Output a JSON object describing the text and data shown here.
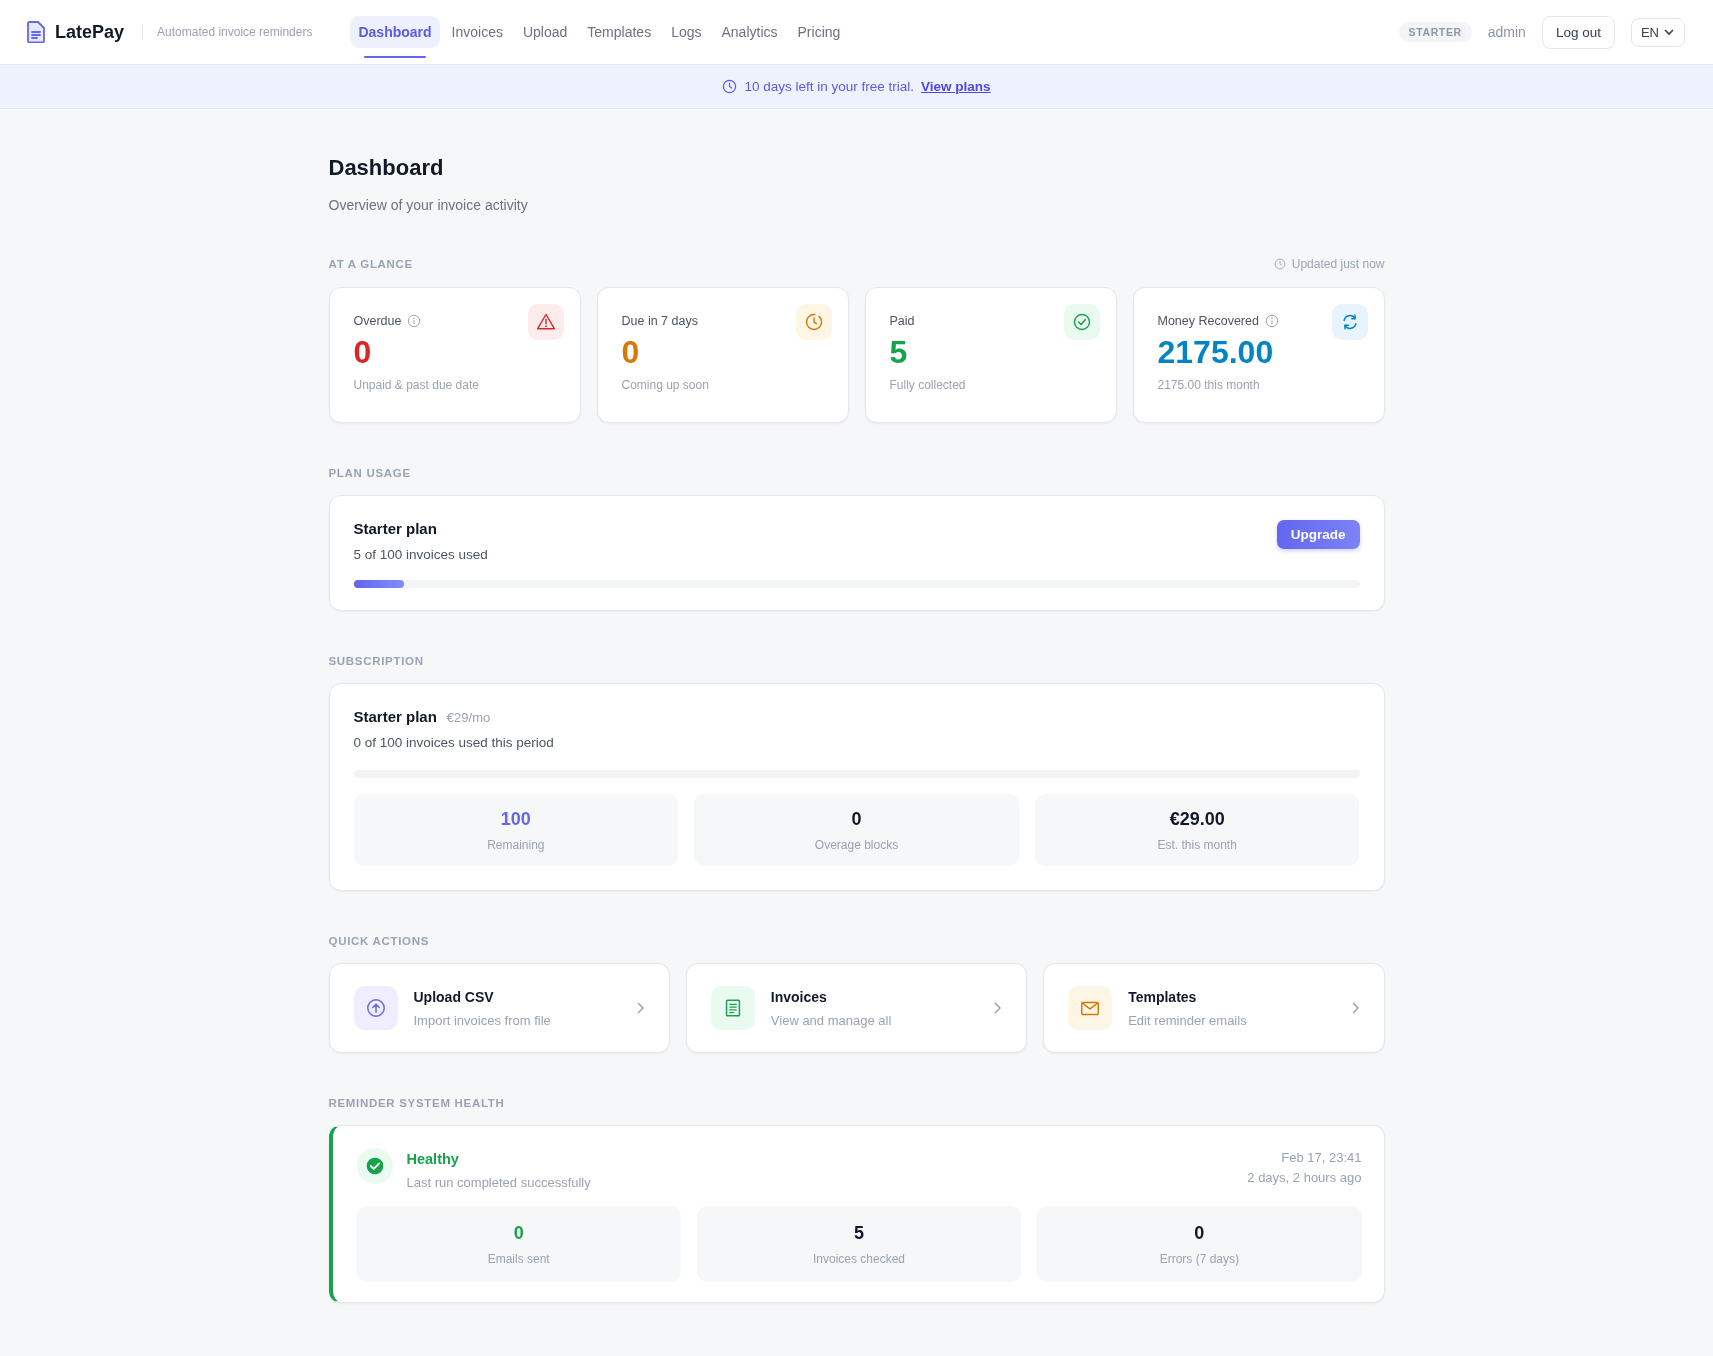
{
  "brand": {
    "name": "LatePay",
    "tagline": "Automated invoice reminders"
  },
  "nav": [
    {
      "label": "Dashboard",
      "selected": true
    },
    {
      "label": "Invoices",
      "selected": false
    },
    {
      "label": "Upload",
      "selected": false
    },
    {
      "label": "Templates",
      "selected": false
    },
    {
      "label": "Logs",
      "selected": false
    },
    {
      "label": "Analytics",
      "selected": false
    },
    {
      "label": "Pricing",
      "selected": false
    }
  ],
  "account": {
    "plan_badge": "STARTER",
    "user": "admin",
    "logout": "Log out",
    "language": "EN"
  },
  "trial_banner": {
    "text": "10 days left in your free trial.",
    "link": "View plans"
  },
  "page": {
    "title": "Dashboard",
    "subtitle": "Overview of your invoice activity"
  },
  "at_a_glance": {
    "heading": "AT A GLANCE",
    "updated": "Updated just now",
    "cards": [
      {
        "kind": "warning",
        "label": "Overdue",
        "info": true,
        "value": "0",
        "note": "Unpaid & past due date",
        "color": "#dc2626"
      },
      {
        "kind": "clock",
        "label": "Due in 7 days",
        "info": false,
        "value": "0",
        "note": "Coming up soon",
        "color": "#d97706"
      },
      {
        "kind": "check",
        "label": "Paid",
        "info": false,
        "value": "5",
        "note": "Fully collected",
        "color": "#16a34a"
      },
      {
        "kind": "refresh",
        "label": "Money Recovered",
        "info": true,
        "value": "2175.00",
        "note": "2175.00 this month",
        "color": "#0284c7"
      }
    ]
  },
  "plan_usage": {
    "heading": "PLAN USAGE",
    "title": "Starter plan",
    "usage": "5 of 100 invoices used",
    "level": 0.05,
    "button": "Upgrade"
  },
  "subscription": {
    "heading": "SUBSCRIPTION",
    "title": "Starter plan",
    "price": "€29/mo",
    "usage": "0 of 100 invoices used this period",
    "level": 0,
    "stats": [
      {
        "value": "100",
        "label": "Remaining",
        "color": "#6366f1"
      },
      {
        "value": "0",
        "label": "Overage blocks",
        "color": "#111827"
      },
      {
        "value": "€29.00",
        "label": "Est. this month",
        "color": "#111827"
      }
    ]
  },
  "quick_actions": {
    "heading": "QUICK ACTIONS",
    "items": [
      {
        "kind": "upload",
        "title": "Upload CSV",
        "subtitle": "Import invoices from file"
      },
      {
        "kind": "invoices",
        "title": "Invoices",
        "subtitle": "View and manage all"
      },
      {
        "kind": "templates",
        "title": "Templates",
        "subtitle": "Edit reminder emails"
      }
    ]
  },
  "health": {
    "heading": "REMINDER SYSTEM HEALTH",
    "healthy": true,
    "status": "Healthy",
    "message": "Last run completed successfully",
    "time": "Feb 17, 23:41",
    "ago": "2 days, 2 hours ago",
    "stats": [
      {
        "value": "0",
        "label": "Emails sent",
        "color": "#16a34a"
      },
      {
        "value": "5",
        "label": "Invoices checked",
        "color": "#111827"
      },
      {
        "value": "0",
        "label": "Errors (7 days)",
        "color": "#111827"
      }
    ]
  }
}
